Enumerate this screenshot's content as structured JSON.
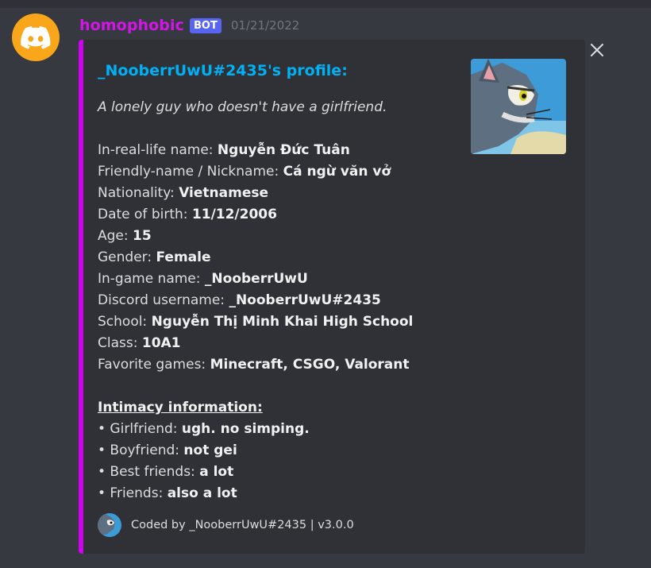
{
  "message": {
    "author": "homophobic",
    "bot_tag": "BOT",
    "timestamp": "01/21/2022"
  },
  "embed": {
    "title": "_NooberrUwU#2435's profile:",
    "subtitle": "A lonely guy who doesn't have a girlfriend.",
    "fields": [
      {
        "label": "In-real-life name: ",
        "value": "Nguyễn Đức Tuân"
      },
      {
        "label": "Friendly-name / Nickname: ",
        "value": "Cá ngừ văn vở"
      },
      {
        "label": "Nationality: ",
        "value": "Vietnamese"
      },
      {
        "label": "Date of birth: ",
        "value": "11/12/2006"
      },
      {
        "label": "Age: ",
        "value": "15"
      },
      {
        "label": "Gender: ",
        "value": "Female"
      },
      {
        "label": "In-game name: ",
        "value": "_NooberrUwU"
      },
      {
        "label": "Discord username: ",
        "value": "_NooberrUwU#2435"
      },
      {
        "label": "School: ",
        "value": "Nguyễn Thị Minh Khai High School"
      },
      {
        "label": "Class: ",
        "value": "10A1"
      },
      {
        "label": "Favorite games: ",
        "value": "Minecraft, CSGO, Valorant"
      }
    ],
    "intimacy_heading": "Intimacy information:",
    "intimacy": [
      {
        "label": "• Girlfriend: ",
        "value": "ugh. no simping."
      },
      {
        "label": "• Boyfriend: ",
        "value": "not gei"
      },
      {
        "label": "• Best friends: ",
        "value": "a lot"
      },
      {
        "label": "• Friends: ",
        "value": "also a lot"
      }
    ],
    "footer": "Coded by _NooberrUwU#2435 | v3.0.0"
  },
  "colors": {
    "author": "#d415e8",
    "accent_bar": "#d000f0",
    "title": "#00b0f4",
    "bot_tag": "#5865f2",
    "avatar_bg": "#faa61a"
  },
  "icons": [
    "discord-logo-icon",
    "close-icon",
    "tom-cat-thumbnail",
    "tom-cat-footer-icon"
  ]
}
